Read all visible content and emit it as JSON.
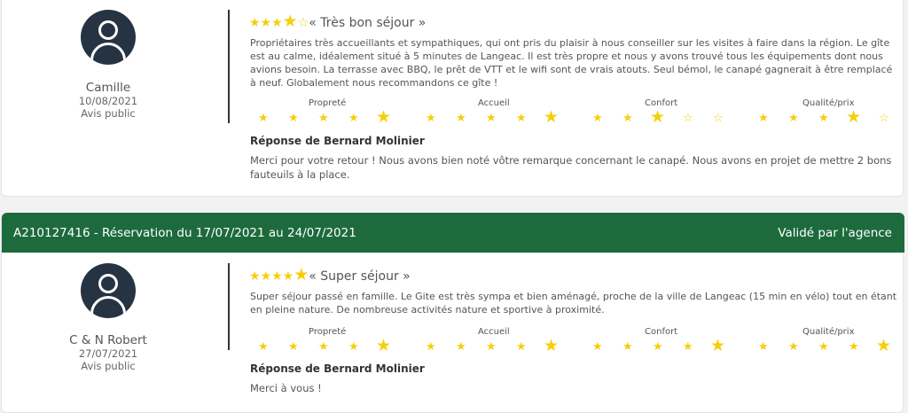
{
  "review1": {
    "author": "Camille",
    "date": "10/08/2021",
    "visibility": "Avis public",
    "rating_title": "« Très bon séjour »",
    "overall_stars": 4,
    "text": "Propriétaires très accueillants et sympathiques, qui ont pris du plaisir à nous conseiller sur les visites à faire dans la région. Le gîte est au calme, idéalement situé à 5 minutes de Langeac. Il est très propre et nous y avons trouvé tous les équipements dont nous avions besoin. La terrasse avec BBQ, le prêt de VTT et le wifi sont de vrais atouts. Seul bémol, le canapé gagnerait à être remplacé à neuf. Globalement nous recommandons ce gîte !",
    "categories": [
      {
        "label": "Propreté",
        "stars": 5
      },
      {
        "label": "Accueil",
        "stars": 5
      },
      {
        "label": "Confort",
        "stars": 3
      },
      {
        "label": "Qualité/prix",
        "stars": 4
      }
    ],
    "response_title": "Réponse de Bernard Molinier",
    "response_text": "Merci pour votre retour ! Nous avons bien noté vôtre remarque concernant le canapé. Nous avons en projet de mettre 2 bons fauteuils à la place."
  },
  "booking2": {
    "reference": "A210127416 - Réservation du 17/07/2021 au 24/07/2021",
    "status": "Validé par l'agence"
  },
  "review2": {
    "author": "C & N Robert",
    "date": "27/07/2021",
    "visibility": "Avis public",
    "rating_title": "« Super séjour »",
    "overall_stars": 5,
    "text": "Super séjour passé en famille. Le Gite est très sympa et bien aménagé, proche de la ville de Langeac (15 min en vélo) tout en étant en pleine nature. De nombreuse activités nature et sportive à proximité.",
    "categories": [
      {
        "label": "Propreté",
        "stars": 5
      },
      {
        "label": "Accueil",
        "stars": 5
      },
      {
        "label": "Confort",
        "stars": 5
      },
      {
        "label": "Qualité/prix",
        "stars": 5
      }
    ],
    "response_title": "Réponse de Bernard Molinier",
    "response_text": "Merci à vous !"
  },
  "colors": {
    "header_green": "#1d6b3d",
    "star_yellow": "#f5cf08",
    "avatar_dark": "#263342"
  },
  "icons": {
    "avatar": "user-avatar-icon",
    "star": "star-icon"
  }
}
